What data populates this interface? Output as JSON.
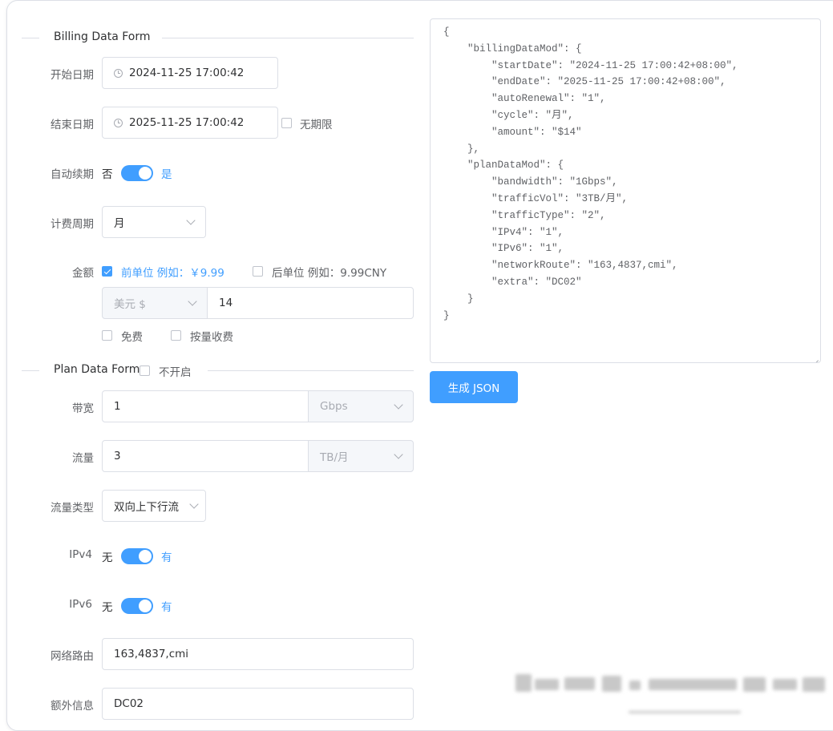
{
  "billing": {
    "title": "Billing Data Form",
    "start_label": "开始日期",
    "start_value": "2024-11-25 17:00:42",
    "end_label": "结束日期",
    "end_value": "2025-11-25 17:00:42",
    "no_limit_label": "无期限",
    "renewal_label": "自动续期",
    "renewal_off": "否",
    "renewal_on": "是",
    "cycle_label": "计费周期",
    "cycle_value": "月",
    "amount_label": "金额",
    "prefix_option": "前单位 例如：￥9.99",
    "suffix_option": "后单位 例如：9.99CNY",
    "currency_value": "美元 $",
    "amount_value": "14",
    "free_label": "免费",
    "usage_label": "按量收费"
  },
  "plan": {
    "title": "Plan Data Form",
    "disable_label": "不开启",
    "bandwidth_label": "带宽",
    "bandwidth_value": "1",
    "bandwidth_unit": "Gbps",
    "traffic_label": "流量",
    "traffic_value": "3",
    "traffic_unit": "TB/月",
    "traffic_type_label": "流量类型",
    "traffic_type_value": "双向上下行流",
    "ipv4_label": "IPv4",
    "ipv4_off": "无",
    "ipv4_on": "有",
    "ipv6_label": "IPv6",
    "ipv6_off": "无",
    "ipv6_on": "有",
    "route_label": "网络路由",
    "route_value": "163,4837,cmi",
    "extra_label": "额外信息",
    "extra_value": "DC02"
  },
  "output": {
    "json_text": "{\n    \"billingDataMod\": {\n        \"startDate\": \"2024-11-25 17:00:42+08:00\",\n        \"endDate\": \"2025-11-25 17:00:42+08:00\",\n        \"autoRenewal\": \"1\",\n        \"cycle\": \"月\",\n        \"amount\": \"$14\"\n    },\n    \"planDataMod\": {\n        \"bandwidth\": \"1Gbps\",\n        \"trafficVol\": \"3TB/月\",\n        \"trafficType\": \"2\",\n        \"IPv4\": \"1\",\n        \"IPv6\": \"1\",\n        \"networkRoute\": \"163,4837,cmi\",\n        \"extra\": \"DC02\"\n    }\n}",
    "generate_label": "生成 JSON"
  },
  "colors": {
    "accent": "#409eff",
    "border": "#dcdfe6",
    "disabled_bg": "#f5f7fa"
  }
}
